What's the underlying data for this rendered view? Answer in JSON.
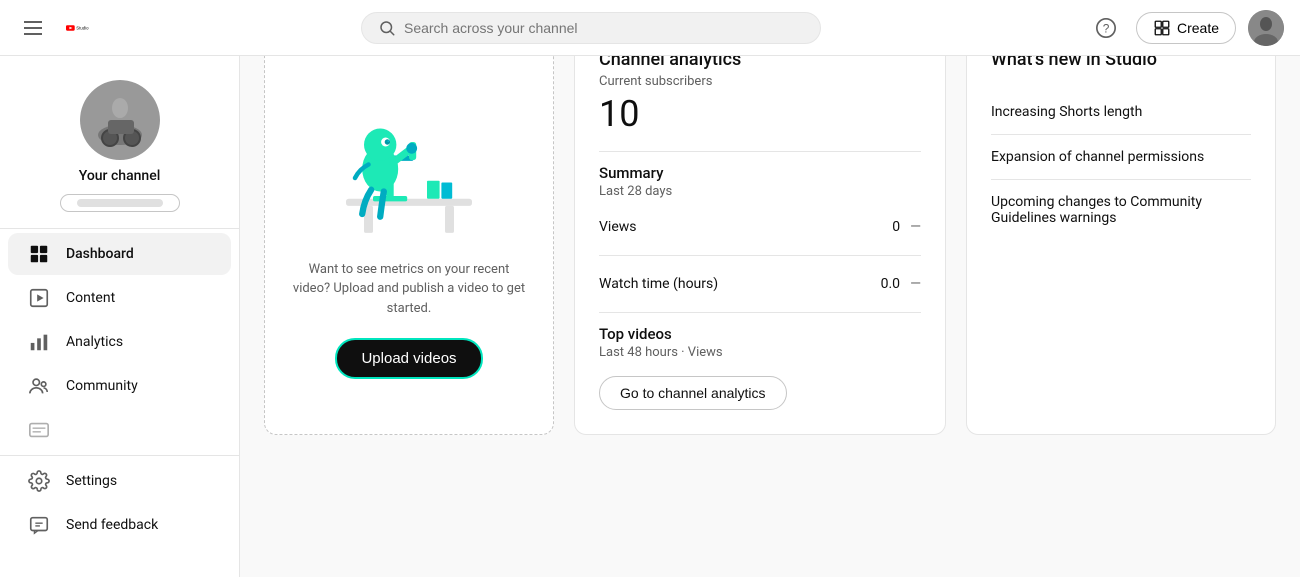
{
  "header": {
    "menu_icon": "☰",
    "logo_text": "Studio",
    "search_placeholder": "Search across your channel",
    "help_icon": "?",
    "create_label": "Create",
    "create_icon": "⊞"
  },
  "sidebar": {
    "channel_name": "Your channel",
    "channel_btn_label": "",
    "nav_items": [
      {
        "id": "dashboard",
        "label": "Dashboard",
        "icon": "grid"
      },
      {
        "id": "content",
        "label": "Content",
        "icon": "content"
      },
      {
        "id": "analytics",
        "label": "Analytics",
        "icon": "analytics"
      },
      {
        "id": "community",
        "label": "Community",
        "icon": "community"
      },
      {
        "id": "subtitles",
        "label": "Subtitles",
        "icon": "subtitles"
      },
      {
        "id": "settings",
        "label": "Settings",
        "icon": "settings"
      },
      {
        "id": "feedback",
        "label": "Send feedback",
        "icon": "feedback"
      }
    ]
  },
  "upload_section": {
    "text": "Want to see metrics on your recent video? Upload and publish a video to get started.",
    "button_label": "Upload videos"
  },
  "channel_analytics": {
    "title": "Channel analytics",
    "subscribers_label": "Current subscribers",
    "subscribers_count": "10",
    "summary_label": "Summary",
    "summary_period": "Last 28 days",
    "metrics": [
      {
        "name": "Views",
        "value": "0",
        "change": "—"
      },
      {
        "name": "Watch time (hours)",
        "value": "0.0",
        "change": "—"
      }
    ],
    "top_videos_label": "Top videos",
    "top_videos_period": "Last 48 hours · Views",
    "goto_button_label": "Go to channel analytics"
  },
  "whats_new": {
    "title": "What's new in Studio",
    "items": [
      {
        "label": "Increasing Shorts length"
      },
      {
        "label": "Expansion of channel permissions"
      },
      {
        "label": "Upcoming changes to Community Guidelines warnings"
      }
    ]
  },
  "colors": {
    "accent": "#00e5be",
    "brand_red": "#ff0000",
    "active_blue": "#065fd4"
  }
}
